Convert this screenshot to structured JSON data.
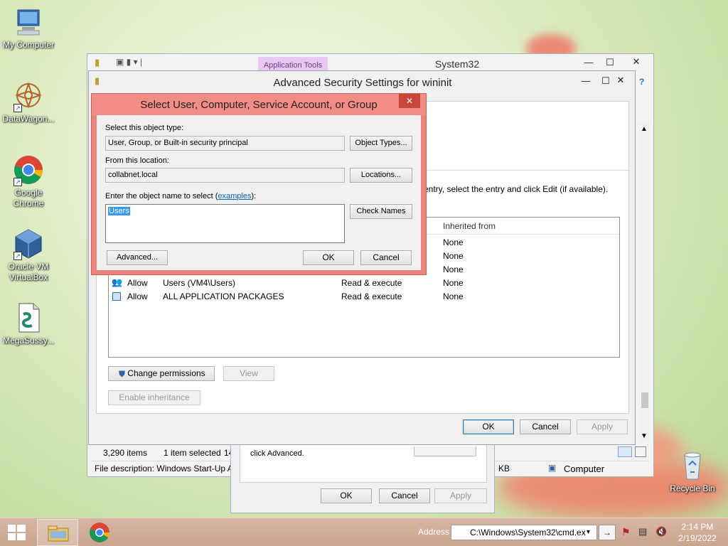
{
  "desktop": {
    "icons": [
      {
        "label": "My Computer",
        "icon": "computer-icon"
      },
      {
        "label": "DataWagon...",
        "icon": "datawagon-icon"
      },
      {
        "label": "Google Chrome",
        "icon": "chrome-icon"
      },
      {
        "label": "Oracle VM VirtualBox",
        "icon": "virtualbox-icon"
      },
      {
        "label": "MegaSussy...",
        "icon": "script-file-icon"
      },
      {
        "label": "Recycle Bin",
        "icon": "recycle-bin-icon"
      }
    ]
  },
  "explorer": {
    "title": "System32",
    "app_tools_tab": "Application Tools",
    "status_items": "3,290 items",
    "status_selected": "1 item selected",
    "status_size_partial": "14",
    "file_description": "File description: Windows Start-Up A",
    "kb_partial": "KB",
    "computer_label": "Computer"
  },
  "props_dialog": {
    "hint": "click Advanced.",
    "ok": "OK",
    "cancel": "Cancel",
    "apply": "Apply"
  },
  "advanced": {
    "title": "Advanced Security Settings for wininit",
    "instruction": "entry, select the entry and click Edit (if available).",
    "col_inherited": "Inherited from",
    "rows": [
      {
        "type": "",
        "principal": "",
        "access": "",
        "inherited": "None"
      },
      {
        "type": "",
        "principal": "",
        "access": "",
        "inherited": "None"
      },
      {
        "type": "",
        "principal": "",
        "access": "",
        "inherited": "None"
      },
      {
        "type": "Allow",
        "principal": "Users (VM4\\Users)",
        "access": "Read & execute",
        "inherited": "None"
      },
      {
        "type": "Allow",
        "principal": "ALL APPLICATION PACKAGES",
        "access": "Read & execute",
        "inherited": "None"
      }
    ],
    "change_permissions": "Change permissions",
    "view": "View",
    "enable_inheritance": "Enable inheritance",
    "ok": "OK",
    "cancel": "Cancel",
    "apply": "Apply"
  },
  "select_dialog": {
    "title": "Select User, Computer, Service Account, or Group",
    "object_type_label": "Select this object type:",
    "object_type_value": "User, Group, or Built-in security principal",
    "object_types_btn": "Object Types...",
    "location_label": "From this location:",
    "location_value": "collabnet.local",
    "locations_btn": "Locations...",
    "enter_label_prefix": "Enter the object name to select (",
    "examples_link": "examples",
    "enter_label_suffix": "):",
    "name_value": "Users",
    "check_names_btn": "Check Names",
    "advanced_btn": "Advanced...",
    "ok": "OK",
    "cancel": "Cancel"
  },
  "taskbar": {
    "address_label": "Address",
    "address_value": "C:\\Windows\\System32\\cmd.ex",
    "time": "2:14 PM",
    "date": "2/19/2022"
  },
  "colors": {
    "dialog_accent": "#e9837c",
    "dialog_title_bg": "#f28d85",
    "close_red": "#c9463d",
    "app_tools": "#e7c8f0",
    "link_blue": "#0066cc",
    "selection_blue": "#3399ff"
  }
}
